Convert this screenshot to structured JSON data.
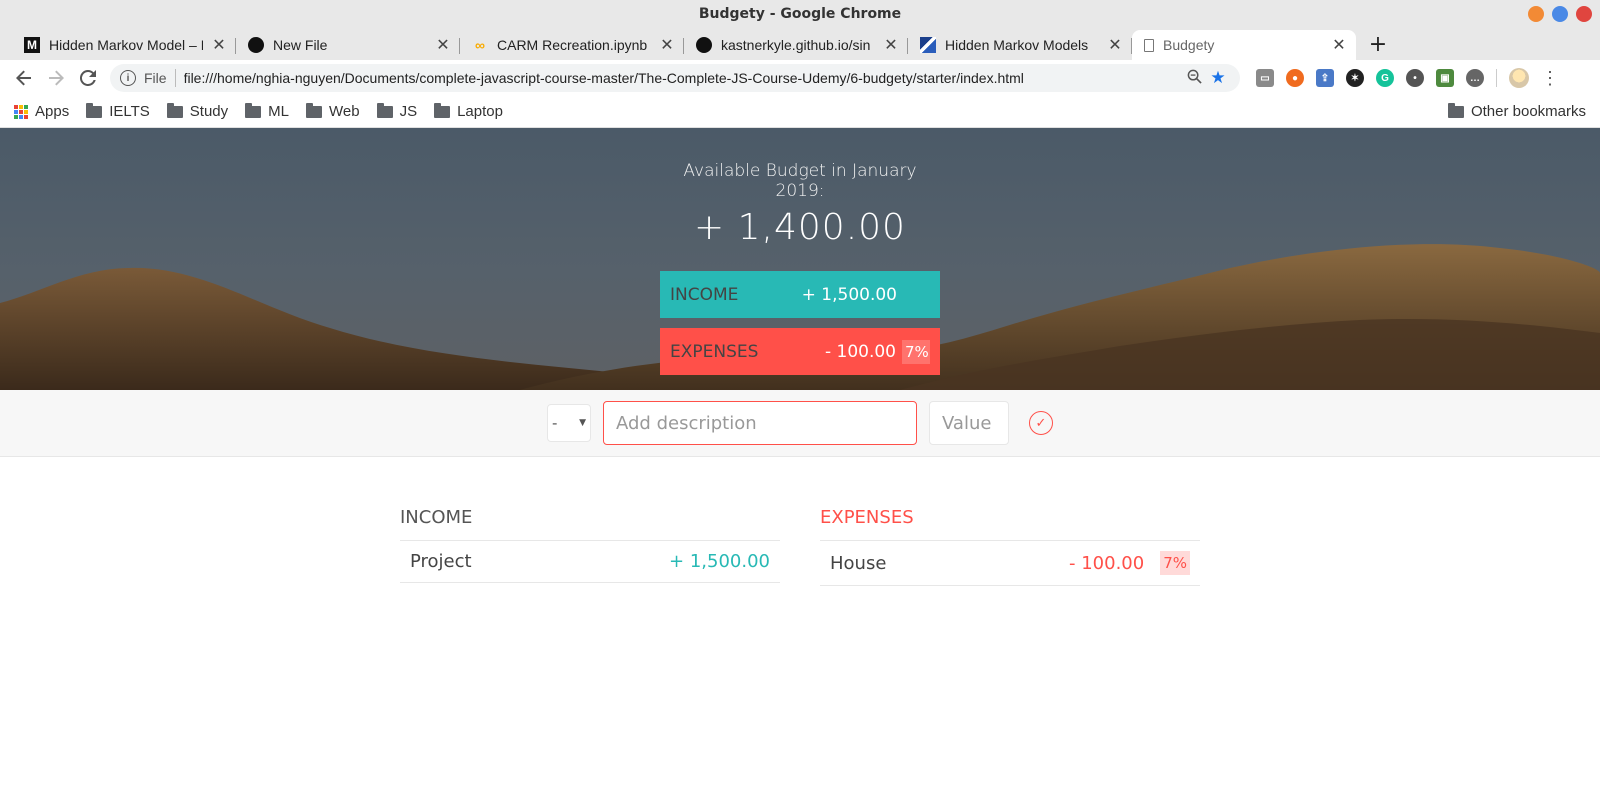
{
  "window": {
    "title": "Budgety - Google Chrome"
  },
  "tabs": [
    {
      "label": "Hidden Markov Model – E",
      "icon": "medium-icon",
      "favicon_text": "M"
    },
    {
      "label": "New File",
      "icon": "github-icon"
    },
    {
      "label": "CARM Recreation.ipynb - C",
      "icon": "colab-icon",
      "favicon_text": "∞"
    },
    {
      "label": "kastnerkyle.github.io/sin",
      "icon": "github-icon"
    },
    {
      "label": "Hidden Markov Models",
      "icon": "hmm-site-icon"
    },
    {
      "label": "Budgety",
      "icon": "document-icon",
      "active": true
    }
  ],
  "toolbar": {
    "scheme": "File",
    "url": "file:///home/nghia-nguyen/Documents/complete-javascript-course-master/The-Complete-JS-Course-Udemy/6-budgety/starter/index.html"
  },
  "bookmarks": {
    "apps": "Apps",
    "folders": [
      "IELTS",
      "Study",
      "ML",
      "Web",
      "JS",
      "Laptop"
    ],
    "other": "Other bookmarks"
  },
  "budget": {
    "title": "Available Budget in January 2019:",
    "value": "+ 1,400.00",
    "income_label": "Income",
    "income_value": "+ 1,500.00",
    "expenses_label": "Expenses",
    "expenses_value": "- 100.00",
    "expenses_percentage": "7%"
  },
  "add": {
    "type_value": "-",
    "description_placeholder": "Add description",
    "value_placeholder": "Value"
  },
  "income": {
    "title": "Income",
    "items": [
      {
        "description": "Project",
        "value": "+ 1,500.00"
      }
    ]
  },
  "expenses": {
    "title": "Expenses",
    "items": [
      {
        "description": "House",
        "value": "- 100.00",
        "percentage": "7%"
      }
    ]
  },
  "colors": {
    "income": "#28b9b5",
    "expenses": "#ff5049",
    "bookmark_star": "#1a73e8"
  }
}
